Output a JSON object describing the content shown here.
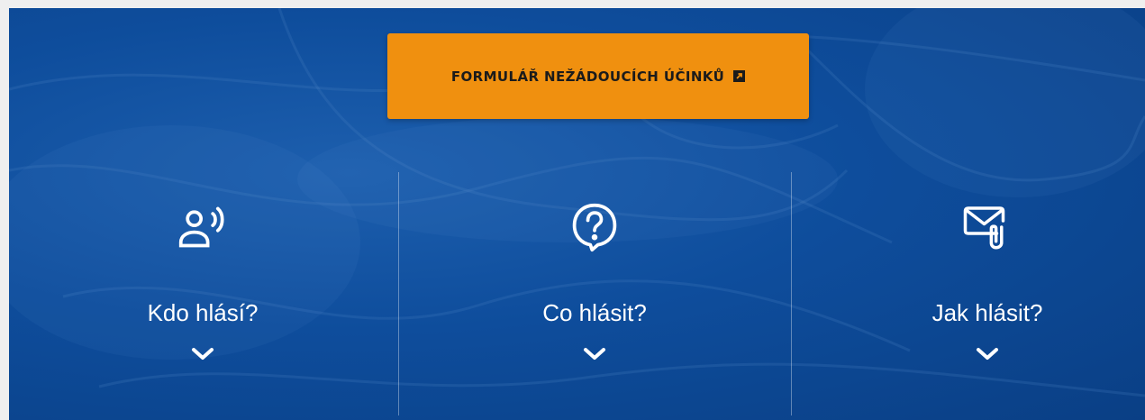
{
  "cta": {
    "label": "FORMULÁŘ NEŽÁDOUCÍCH ÚČINKŮ",
    "icon": "external-link-icon",
    "background": "#f0900f"
  },
  "hero": {
    "background": "#0e4d9c"
  },
  "sections": [
    {
      "title": "Kdo hlásí?",
      "icon": "person-speaking-icon"
    },
    {
      "title": "Co hlásit?",
      "icon": "question-bubble-icon"
    },
    {
      "title": "Jak hlásit?",
      "icon": "mail-attachment-icon"
    }
  ]
}
